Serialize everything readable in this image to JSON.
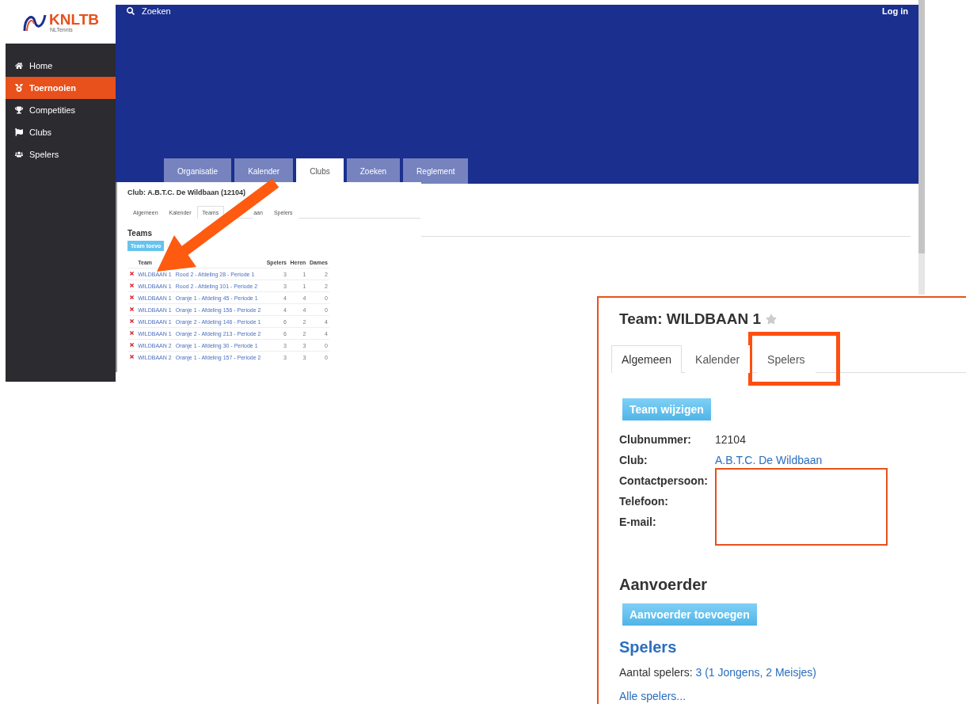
{
  "logo": {
    "name": "KNLTB",
    "tagline": "NLTennis"
  },
  "sidebar": {
    "items": [
      {
        "label": "Home",
        "selected": false
      },
      {
        "label": "Toernooien",
        "selected": true
      },
      {
        "label": "Competities",
        "selected": false
      },
      {
        "label": "Clubs",
        "selected": false
      },
      {
        "label": "Spelers",
        "selected": false
      }
    ]
  },
  "header": {
    "search_label": "Zoeken",
    "login": "Log in",
    "tabs": [
      {
        "label": "Organisatie",
        "selected": false
      },
      {
        "label": "Kalender",
        "selected": false
      },
      {
        "label": "Clubs",
        "selected": true
      },
      {
        "label": "Zoeken",
        "selected": false
      },
      {
        "label": "Reglement",
        "selected": false
      }
    ]
  },
  "club_inset": {
    "title": "Club: A.B.T.C. De Wildbaan (12104)",
    "tabs": [
      {
        "label": "Algemeen",
        "selected": false
      },
      {
        "label": "Kalender",
        "selected": false
      },
      {
        "label": "Teams",
        "selected": true
      },
      {
        "label": "aan",
        "selected": false,
        "cut": true
      },
      {
        "label": "Spelers",
        "selected": false
      }
    ],
    "section": "Teams",
    "add_button": "Team toevo",
    "columns": [
      "Team",
      "Spelers",
      "Heren",
      "Dames"
    ],
    "rows": [
      {
        "team": "WILDBAAN 1",
        "competition": "Rood 2 - Afdeling 28 - Periode 1",
        "spelers": "3",
        "heren": "1",
        "dames": "2"
      },
      {
        "team": "WILDBAAN 1",
        "competition": "Rood 2 - Afdeling 101 - Periode 2",
        "spelers": "3",
        "heren": "1",
        "dames": "2"
      },
      {
        "team": "WILDBAAN 1",
        "competition": "Oranje 1 - Afdeling 45 - Periode 1",
        "spelers": "4",
        "heren": "4",
        "dames": "0"
      },
      {
        "team": "WILDBAAN 1",
        "competition": "Oranje 1 - Afdeling 156 - Periode 2",
        "spelers": "4",
        "heren": "4",
        "dames": "0"
      },
      {
        "team": "WILDBAAN 1",
        "competition": "Oranje 2 - Afdeling 146 - Periode 1",
        "spelers": "6",
        "heren": "2",
        "dames": "4"
      },
      {
        "team": "WILDBAAN 1",
        "competition": "Oranje 2 - Afdeling 213 - Periode 2",
        "spelers": "6",
        "heren": "2",
        "dames": "4"
      },
      {
        "team": "WILDBAAN 2",
        "competition": "Oranje 1 - Afdeling 30 - Periode 1",
        "spelers": "3",
        "heren": "3",
        "dames": "0"
      },
      {
        "team": "WILDBAAN 2",
        "competition": "Oranje 1 - Afdeling 157 - Periode 2",
        "spelers": "3",
        "heren": "3",
        "dames": "0"
      }
    ]
  },
  "team_panel": {
    "title": "Team: WILDBAAN 1",
    "favorite": false,
    "tabs": [
      {
        "label": "Algemeen",
        "selected": true,
        "highlighted": false
      },
      {
        "label": "Kalender",
        "selected": false,
        "highlighted": false
      },
      {
        "label": "Spelers",
        "selected": false,
        "highlighted": true
      }
    ],
    "edit_button": "Team wijzigen",
    "fields": [
      {
        "label": "Clubnummer:",
        "kind": "text",
        "value": "12104"
      },
      {
        "label": "Club:",
        "kind": "link",
        "value": "A.B.T.C. De Wildbaan"
      },
      {
        "label": "Contactpersoon:",
        "kind": "redacted"
      },
      {
        "label": "Telefoon:",
        "kind": "redacted"
      },
      {
        "label": "E-mail:",
        "kind": "redacted"
      }
    ],
    "captain": {
      "heading": "Aanvoerder",
      "button": "Aanvoerder toevoegen"
    },
    "players": {
      "heading": "Spelers",
      "count_label": "Aantal spelers:",
      "count_link": "3 (1 Jongens, 2 Meisjes)",
      "all_link": "Alle spelers..."
    }
  }
}
